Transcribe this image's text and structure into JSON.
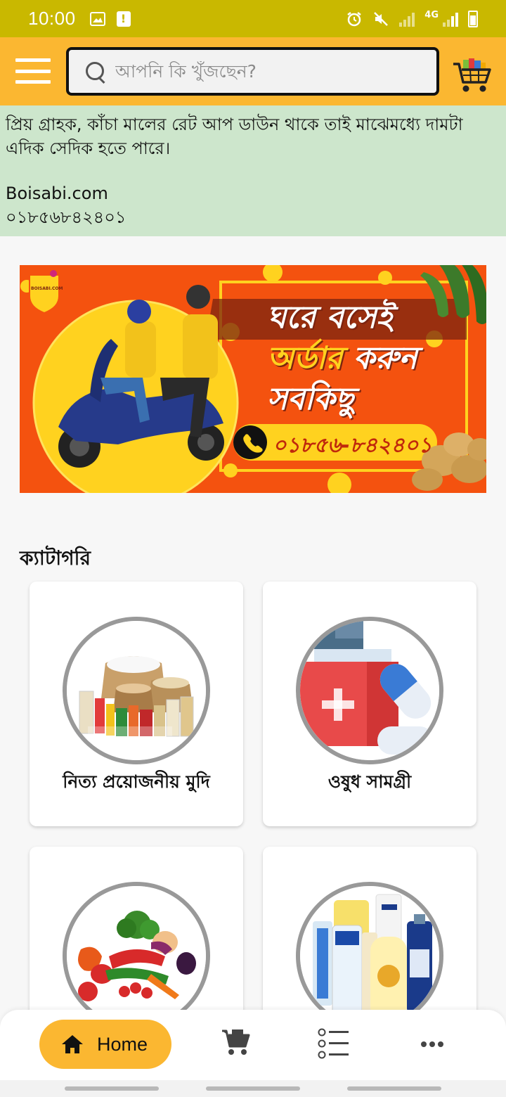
{
  "status_bar": {
    "time": "10:00",
    "network": "4G",
    "icons": [
      "image-icon",
      "alert-icon",
      "alarm-icon",
      "mute-icon",
      "signal-icon",
      "signal-4g-icon",
      "battery-icon"
    ]
  },
  "app_bar": {
    "search_placeholder": "আপনি কি খুঁজছেন?",
    "icons": [
      "menu-icon",
      "search-icon",
      "cart-icon"
    ]
  },
  "notice": {
    "message": "প্রিয় গ্রাহক, কাঁচা মালের রেট আপ ডাউন থাকে তাই মাঝেমধ্যে দামটা এদিক সেদিক হতে পারে।",
    "site": "Boisabi.com",
    "phone": "০১৮৫৬৮৪২৪০১"
  },
  "banner": {
    "logo_text": "BOISABI.COM",
    "line1": "ঘরে বসেই",
    "line2_a": "অর্ডার",
    "line2_b": " করুন",
    "line3": "সবকিছু",
    "phone": "০১৮৫৬-৮৪২৪০১"
  },
  "categories": {
    "title": "ক্যাটাগরি",
    "items": [
      {
        "label": "নিত্য প্রয়োজনীয় মুদি",
        "image": "grocery-image"
      },
      {
        "label": "ওষুধ সামগ্রী",
        "image": "medicine-image"
      },
      {
        "label": "",
        "image": "vegetables-image"
      },
      {
        "label": "",
        "image": "cosmetics-image"
      }
    ]
  },
  "bottom_nav": {
    "home_label": "Home",
    "icons": [
      "home-icon",
      "cart-icon",
      "list-icon",
      "more-icon"
    ]
  },
  "colors": {
    "status_bar": "#c9b800",
    "accent": "#fbb731",
    "notice_bg": "#cde6cc",
    "banner_orange": "#f4520f",
    "banner_yellow": "#ffd21f"
  }
}
